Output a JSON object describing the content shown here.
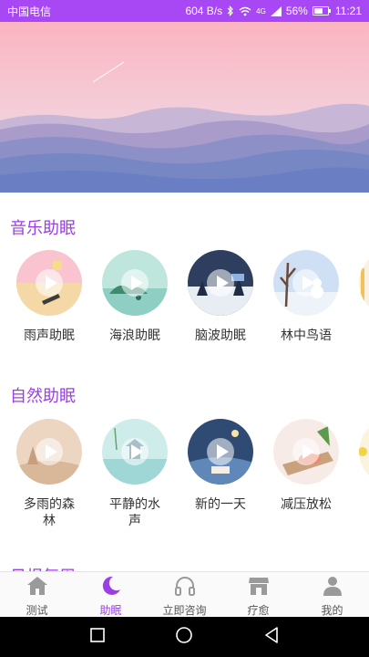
{
  "status_bar": {
    "carrier": "中国电信",
    "speed": "604 B/s",
    "network": "4G",
    "battery": "56%",
    "time": "11:21"
  },
  "sections": [
    {
      "title": "音乐助眠",
      "items": [
        {
          "label": "雨声助眠",
          "icon": "rain-scene"
        },
        {
          "label": "海浪助眠",
          "icon": "sea-island-scene"
        },
        {
          "label": "脑波助眠",
          "icon": "night-forest-scene"
        },
        {
          "label": "林中鸟语",
          "icon": "winter-tree-scene"
        }
      ]
    },
    {
      "title": "自然助眠",
      "items": [
        {
          "label": "多雨的森林",
          "icon": "rainy-forest-scene"
        },
        {
          "label": "平静的水声",
          "icon": "pagoda-water-scene"
        },
        {
          "label": "新的一天",
          "icon": "dawn-village-scene"
        },
        {
          "label": "减压放松",
          "icon": "fish-table-scene"
        }
      ]
    },
    {
      "title": "日报每周"
    }
  ],
  "tabs": [
    {
      "label": "测试",
      "icon": "home-icon",
      "active": false
    },
    {
      "label": "助眠",
      "icon": "moon-icon",
      "active": true
    },
    {
      "label": "立即咨询",
      "icon": "headphones-icon",
      "active": false
    },
    {
      "label": "疗愈",
      "icon": "shop-icon",
      "active": false
    },
    {
      "label": "我的",
      "icon": "person-icon",
      "active": false
    }
  ],
  "colors": {
    "accent": "#9b3ee8",
    "status_bar": "#a848f5"
  }
}
